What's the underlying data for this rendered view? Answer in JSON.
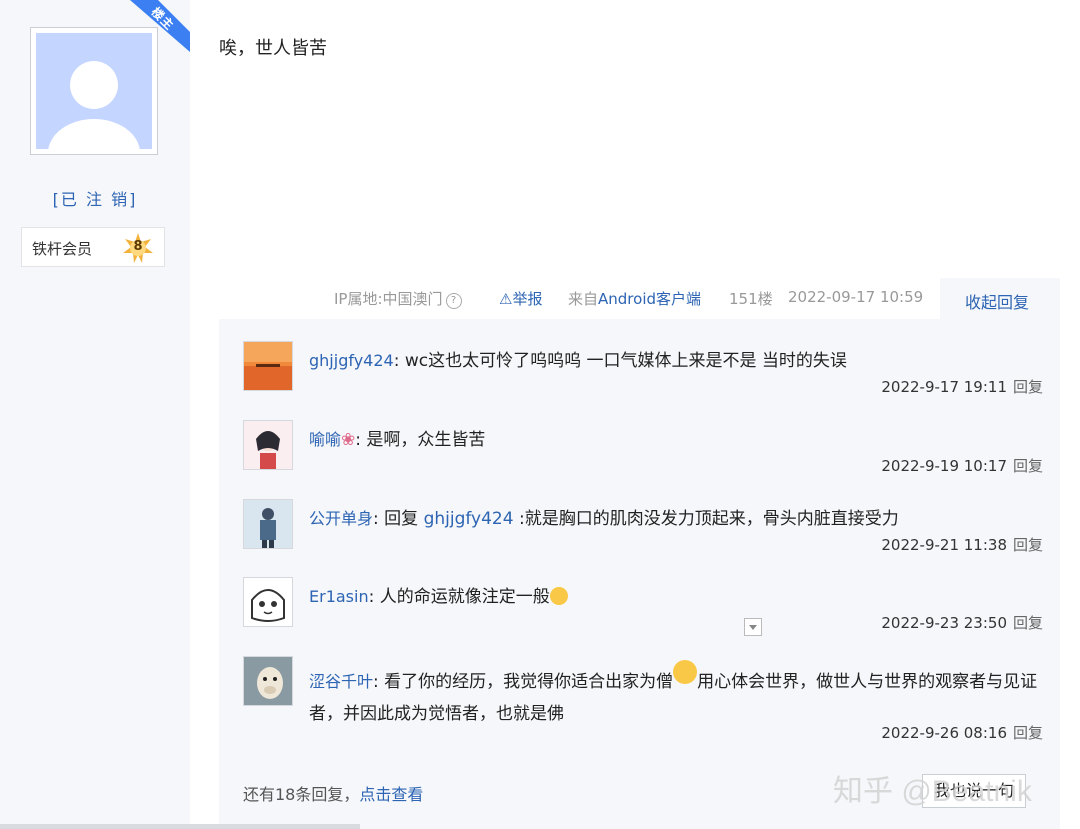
{
  "author": {
    "op_badge": "楼主",
    "username": "[已 注 销]",
    "member_label": "铁杆会员",
    "member_level": "8",
    "avatar_icon": "default-user-avatar-icon"
  },
  "post": {
    "content": "唉，世人皆苦",
    "ip_location": "IP属地:中国澳门",
    "report": "⚠举报",
    "source_prefix": "来自",
    "source_client": "Android客户端",
    "floor": "151楼",
    "time": "2022-09-17 10:59",
    "collapse_replies": "收起回复"
  },
  "replies": [
    {
      "nick": "ghjjgfy424",
      "text": ": wc这也太可怜了呜呜呜 一口气媒体上来是不是 当时的失误",
      "time": "2022-9-17 19:11",
      "reply_label": "回复"
    },
    {
      "nick": "喻喻",
      "nick_emoji": "❀",
      "text": ": 是啊，众生皆苦",
      "time": "2022-9-19 10:17",
      "reply_label": "回复"
    },
    {
      "nick": "公开单身",
      "text_prefix": ": 回复 ",
      "mention": "ghjjgfy424",
      "text": " :就是胸口的肌肉没发力顶起来，骨头内脏直接受力",
      "time": "2022-9-21 11:38",
      "reply_label": "回复"
    },
    {
      "nick": "Er1asin",
      "text": ": 人的命运就像注定一般",
      "time": "2022-9-23 23:50",
      "reply_label": "回复"
    },
    {
      "nick": "涩谷千叶",
      "text": ": 看了你的经历，我觉得你适合出家为僧",
      "text_after_emoji": "用心体会世界，做世人与世界的观察者与见证者，并因此成为觉悟者，也就是佛",
      "time": "2022-9-26 08:16",
      "reply_label": "回复"
    }
  ],
  "more_replies": {
    "prefix": "还有18条回复，",
    "link": "点击查看"
  },
  "say_button": "我也说一句",
  "watermark": "知乎 @Beatnik",
  "colors": {
    "link": "#2d64b3",
    "panel_bg": "#f5f7fa",
    "badge": "#3b7ff2",
    "level_star": "#f2b33d"
  }
}
